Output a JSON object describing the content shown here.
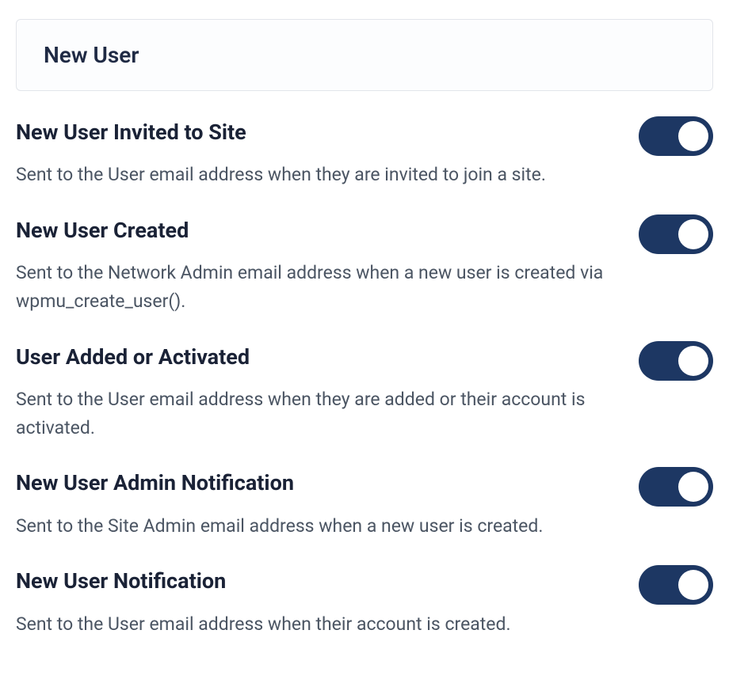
{
  "section": {
    "title": "New User"
  },
  "settings": [
    {
      "title": "New User Invited to Site",
      "description": "Sent to the User email address when they are invited to join a site.",
      "enabled": true
    },
    {
      "title": "New User Created",
      "description": "Sent to the Network Admin email address when a new user is created via wpmu_create_user().",
      "enabled": true
    },
    {
      "title": "User Added or Activated",
      "description": "Sent to the User email address when they are added or their account is activated.",
      "enabled": true
    },
    {
      "title": "New User Admin Notification",
      "description": "Sent to the Site Admin email address when a new user is created.",
      "enabled": true
    },
    {
      "title": "New User Notification",
      "description": "Sent to the User email address when their account is created.",
      "enabled": true
    }
  ]
}
